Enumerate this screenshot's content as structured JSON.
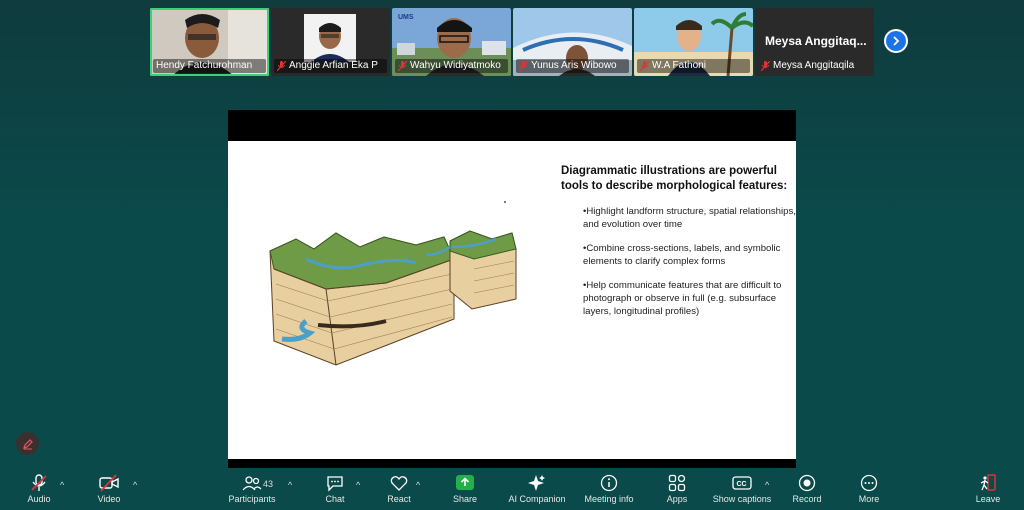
{
  "participants": [
    {
      "name": "Hendy Fatchurohman",
      "muted": false,
      "active": true
    },
    {
      "name": "Anggie Arfian Eka P",
      "muted": true
    },
    {
      "name": "Wahyu Widiyatmoko",
      "muted": true
    },
    {
      "name": "Yunus Aris Wibowo",
      "muted": true
    },
    {
      "name": "W.A Fathoni",
      "muted": true
    },
    {
      "name": "Meysa Anggitaqila",
      "muted": true,
      "display_name": "Meysa Anggitaq..."
    }
  ],
  "slide": {
    "title": "Diagrammatic illustrations are powerful tools to describe morphological features:",
    "bullets": [
      "•Highlight landform structure, spatial relationships, and evolution over time",
      "•Combine cross-sections, labels, and symbolic elements to clarify complex forms",
      "•Help communicate features that are difficult to photograph or observe in full (e.g. subsurface layers, longitudinal profiles)"
    ]
  },
  "toolbar": {
    "audio": "Audio",
    "video": "Video",
    "participants": "Participants",
    "participants_count": "43",
    "chat": "Chat",
    "react": "React",
    "share": "Share",
    "ai_companion": "AI Companion",
    "meeting_info": "Meeting info",
    "apps": "Apps",
    "show_captions": "Show captions",
    "record": "Record",
    "more": "More",
    "leave": "Leave"
  },
  "colors": {
    "share_green": "#22b04a",
    "active_outline": "#3bd17a",
    "mute_red": "#e0333a",
    "next_blue": "#1a73e8"
  }
}
